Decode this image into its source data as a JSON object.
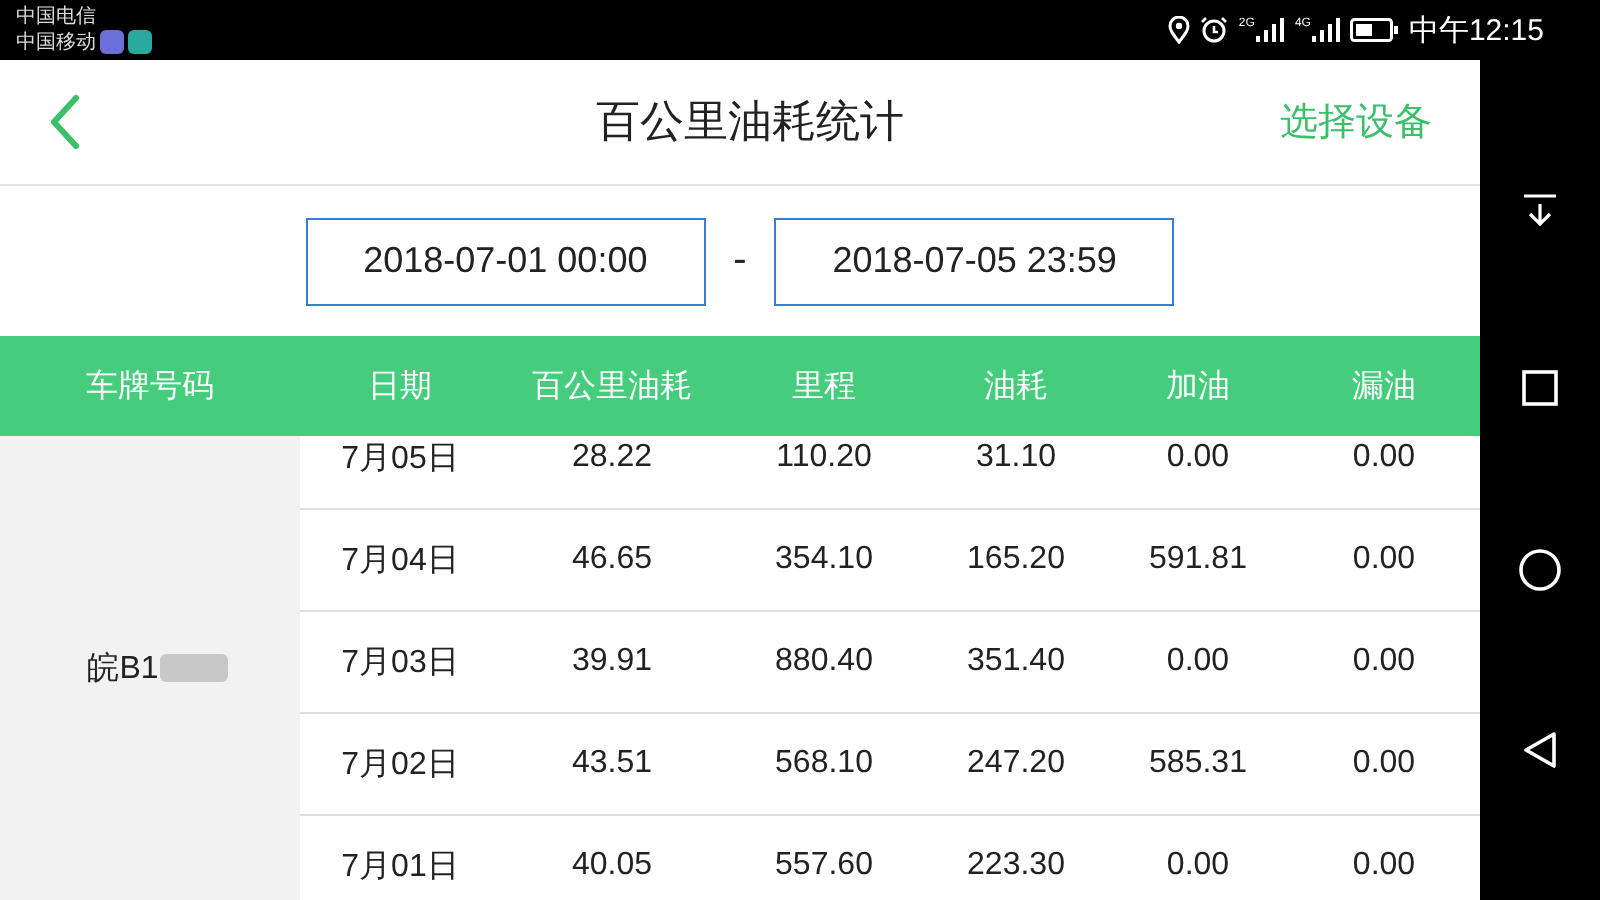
{
  "status_bar": {
    "carriers": [
      "中国电信",
      "中国移动"
    ],
    "network_labels": [
      "2G",
      "4G"
    ],
    "time": "中午12:15"
  },
  "header": {
    "title": "百公里油耗统计",
    "action": "选择设备"
  },
  "date_range": {
    "start": "2018-07-01 00:00",
    "separator": "-",
    "end": "2018-07-05 23:59"
  },
  "table": {
    "columns": [
      "车牌号码",
      "日期",
      "百公里油耗",
      "里程",
      "油耗",
      "加油",
      "漏油"
    ],
    "rows": [
      [
        "",
        "7月05日",
        "28.22",
        "110.20",
        "31.10",
        "0.00",
        "0.00"
      ],
      [
        "",
        "7月04日",
        "46.65",
        "354.10",
        "165.20",
        "591.81",
        "0.00"
      ],
      [
        "皖B1",
        "7月03日",
        "39.91",
        "880.40",
        "351.40",
        "0.00",
        "0.00"
      ],
      [
        "",
        "7月02日",
        "43.51",
        "568.10",
        "247.20",
        "585.31",
        "0.00"
      ],
      [
        "",
        "7月01日",
        "40.05",
        "557.60",
        "223.30",
        "0.00",
        "0.00"
      ]
    ]
  }
}
